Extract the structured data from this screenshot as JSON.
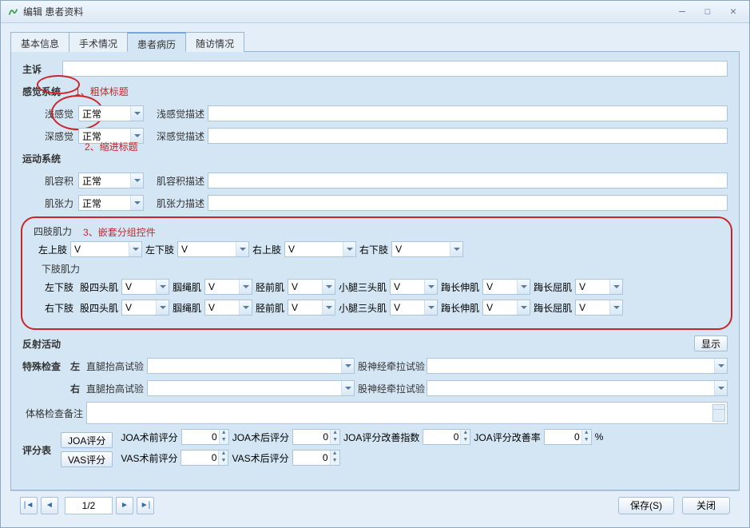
{
  "window": {
    "title": "编辑 患者资料"
  },
  "tabs": [
    "基本信息",
    "手术情况",
    "患者病历",
    "随访情况"
  ],
  "active_tab": "患者病历",
  "annotations": {
    "a1": "1、粗体标题",
    "a2": "2、缩进标题",
    "a3": "3、嵌套分组控件"
  },
  "form": {
    "chief_complaint_label": "主诉",
    "sensory_section": "感觉系统",
    "superficial_label": "浅感觉",
    "superficial_value": "正常",
    "superficial_desc_label": "浅感觉描述",
    "deep_label": "深感觉",
    "deep_value": "正常",
    "deep_desc_label": "深感觉描述",
    "motor_section": "运动系统",
    "muscle_volume_label": "肌容积",
    "muscle_volume_value": "正常",
    "muscle_volume_desc_label": "肌容积描述",
    "muscle_tone_label": "肌张力",
    "muscle_tone_value": "正常",
    "muscle_tone_desc_label": "肌张力描述",
    "limb_strength_section": "四肢肌力",
    "limbs": {
      "lu": "左上肢",
      "ll": "左下肢",
      "ru": "右上肢",
      "rl": "右下肢",
      "v": "V"
    },
    "lower_limb_section": "下肢肌力",
    "ll_left": "左下肢",
    "ll_right": "右下肢",
    "muscles": {
      "quad": "股四头肌",
      "ham": "腘绳肌",
      "tib": "胫前肌",
      "calf": "小腿三头肌",
      "ehl": "踇长伸肌",
      "fhl": "踇长屈肌",
      "v": "V"
    },
    "reflex_section": "反射活动",
    "show_btn": "显示",
    "special_exam_label": "特殊检查",
    "left": "左",
    "right": "右",
    "slr_label": "直腿抬高试验",
    "femoral_label": "股神经牵拉试验",
    "remark_label": "体格检查备注",
    "score_section": "评分表",
    "joa_btn": "JOA评分",
    "vas_btn": "VAS评分",
    "joa_pre": "JOA术前评分",
    "joa_post": "JOA术后评分",
    "joa_improve_idx": "JOA评分改善指数",
    "joa_improve_rate": "JOA评分改善率",
    "vas_pre": "VAS术前评分",
    "vas_post": "VAS术后评分",
    "zero": "0",
    "percent": "%"
  },
  "footer": {
    "pager": "1/2",
    "save": "保存(S)",
    "close": "关闭"
  }
}
